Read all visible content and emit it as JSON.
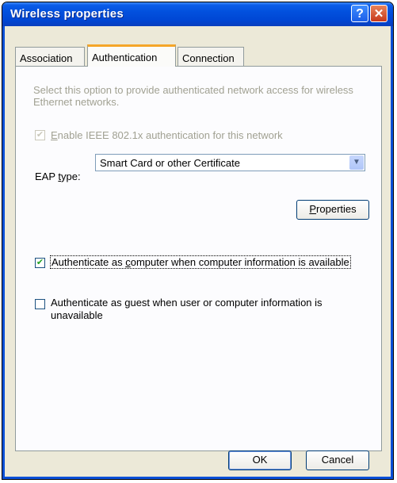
{
  "window": {
    "title": "Wireless properties",
    "help_glyph": "?",
    "close_glyph": "✕"
  },
  "tabs": [
    {
      "label": "Association",
      "selected": false
    },
    {
      "label": "Authentication",
      "selected": true
    },
    {
      "label": "Connection",
      "selected": false
    }
  ],
  "authentication": {
    "description": "Select this option to provide authenticated network access for wireless Ethernet networks.",
    "enable_8021x": {
      "label_accel": "E",
      "label_rest": "nable IEEE 802.1x authentication for this network",
      "checked": true,
      "disabled": true
    },
    "eap_type": {
      "label_pre": "EAP ",
      "label_accel": "t",
      "label_post": "ype:",
      "value": "Smart Card or other Certificate"
    },
    "properties_button": {
      "accel": "P",
      "rest": "roperties"
    },
    "auth_computer": {
      "label_pre": "Authenticate as ",
      "label_accel": "c",
      "label_post": "omputer when computer information is available",
      "checked": true
    },
    "auth_guest": {
      "label_pre": "Authenticate as ",
      "label_accel": "g",
      "label_post": "uest when user or computer information is unavailable",
      "checked": false
    }
  },
  "buttons": {
    "ok": "OK",
    "cancel": "Cancel"
  },
  "icons": {
    "checkmark": "✔",
    "dropdown_arrow": "▼"
  }
}
